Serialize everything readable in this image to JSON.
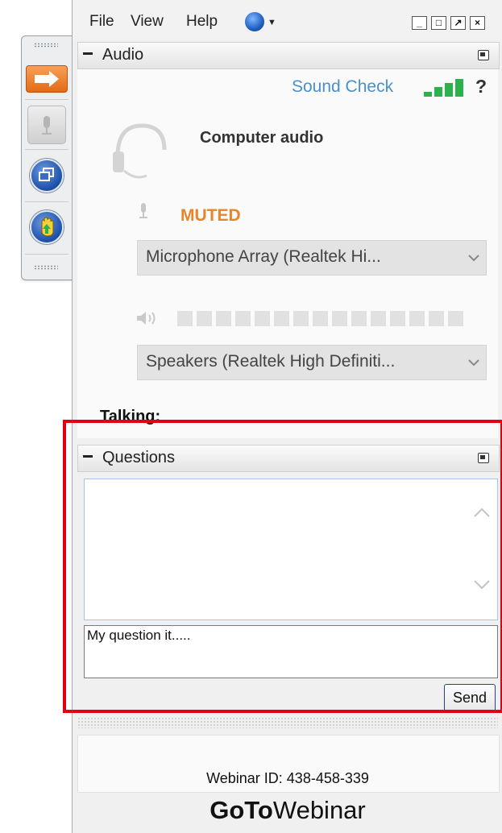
{
  "menu": {
    "file": "File",
    "view": "View",
    "help": "Help"
  },
  "window_controls": {
    "minimize": "_",
    "restore": "□",
    "popout": "↗",
    "close": "×"
  },
  "audio_panel": {
    "title": "Audio",
    "sound_check": "Sound Check",
    "help": "?",
    "mode": "Computer audio",
    "mic_status": "MUTED",
    "microphone_device": "Microphone Array (Realtek Hi...",
    "speaker_device": "Speakers (Realtek High Definiti...",
    "talking_label": "Talking:"
  },
  "questions_panel": {
    "title": "Questions",
    "input_text": "My question it.....",
    "send_label": "Send"
  },
  "footer": {
    "webinar_id": "Webinar ID: 438-458-339",
    "brand_bold": "GoTo",
    "brand_regular": "Webinar"
  },
  "colors": {
    "accent_blue": "#4a90c8",
    "muted_orange": "#e8842a",
    "signal_green": "#2bb24c",
    "highlight_red": "#e4000f"
  }
}
